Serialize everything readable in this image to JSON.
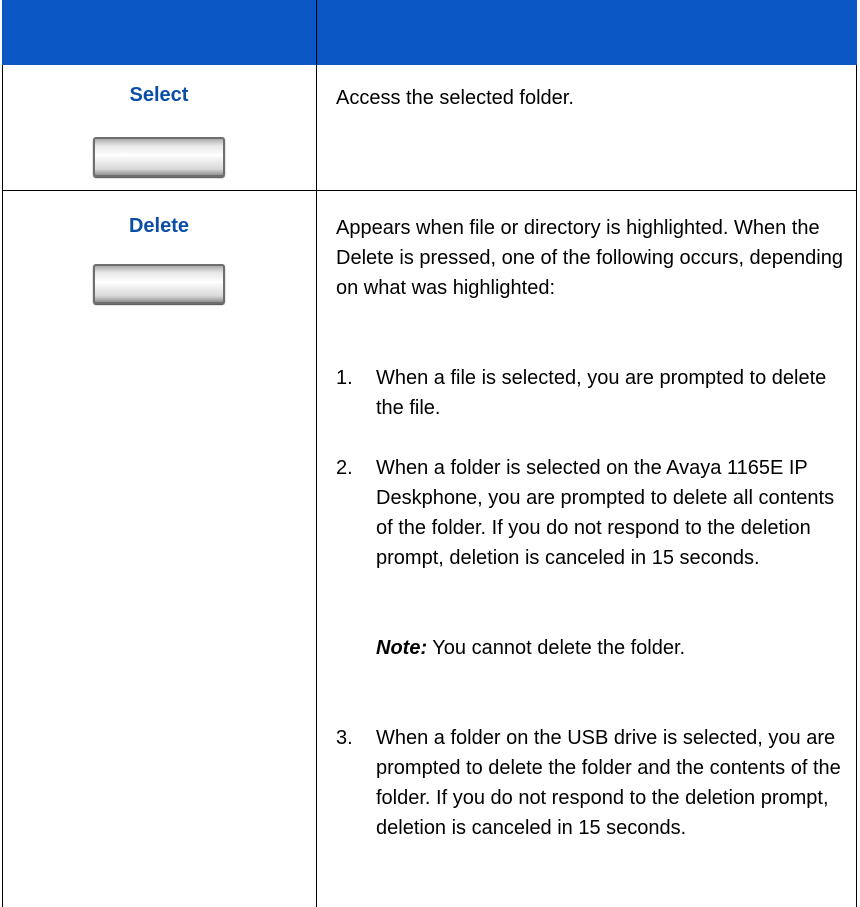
{
  "rows": [
    {
      "key": "Select",
      "description": "Access the selected folder."
    },
    {
      "key": "Delete",
      "description": "Appears when file or directory is highlighted. When the Delete is pressed, one of the following occurs, depending on what was highlighted:",
      "items": [
        {
          "num": "1.",
          "text": "When a file is selected, you are prompted to delete the file."
        },
        {
          "num": "2.",
          "text": "When a folder is selected on the Avaya 1165E IP Deskphone, you are prompted to delete all contents of the folder. If you do not respond to the deletion prompt, deletion is canceled in 15 seconds."
        },
        {
          "num": "3.",
          "text": "When a folder on the USB drive is selected, you are prompted to delete the folder and the contents of the folder. If you do not respond to the deletion prompt, deletion is canceled in 15 seconds."
        }
      ],
      "note": {
        "label": "Note:",
        "text": " You cannot delete the folder."
      }
    }
  ],
  "colors": {
    "header": "#0b57c6",
    "key_label": "#0b4ea8"
  }
}
